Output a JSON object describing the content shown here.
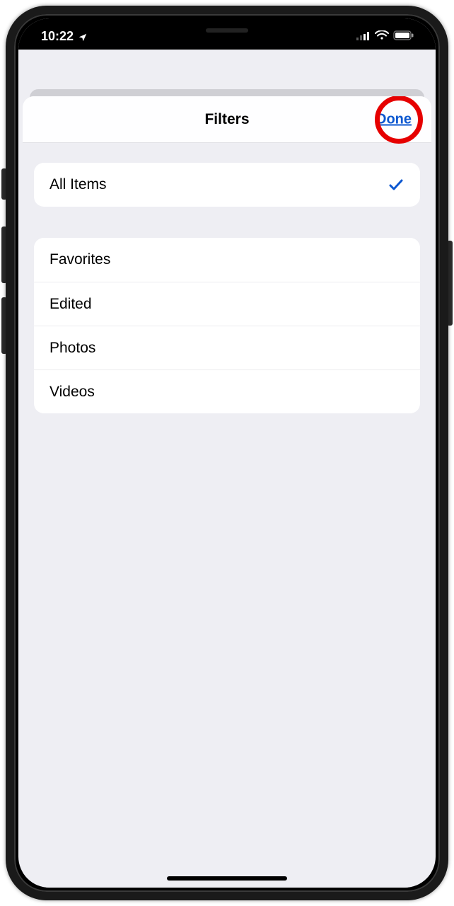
{
  "status": {
    "time": "10:22"
  },
  "sheet": {
    "title": "Filters",
    "done_label": "Done",
    "primary": {
      "label": "All Items",
      "selected": true
    },
    "options": [
      {
        "label": "Favorites"
      },
      {
        "label": "Edited"
      },
      {
        "label": "Photos"
      },
      {
        "label": "Videos"
      }
    ]
  },
  "annotation": {
    "highlight_done": true
  }
}
